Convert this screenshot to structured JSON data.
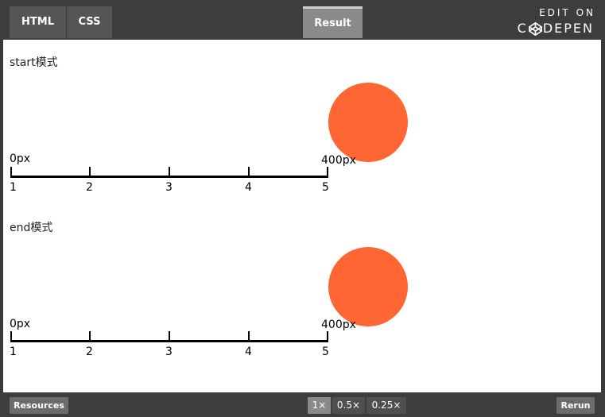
{
  "topbar": {
    "tabs": [
      {
        "label": "HTML"
      },
      {
        "label": "CSS"
      },
      {
        "label": "Result"
      }
    ],
    "brand": {
      "edit_on": "EDIT ON",
      "logo_prefix": "C",
      "logo_suffix": "DEPEN"
    }
  },
  "result": {
    "demos": [
      {
        "title": "start模式",
        "start_label": "0px",
        "end_label": "400px",
        "ticks": [
          "1",
          "2",
          "3",
          "4",
          "5"
        ]
      },
      {
        "title": "end模式",
        "start_label": "0px",
        "end_label": "400px",
        "ticks": [
          "1",
          "2",
          "3",
          "4",
          "5"
        ]
      }
    ],
    "circle_color": "#ff6633"
  },
  "bottombar": {
    "resources_label": "Resources",
    "zoom_options": [
      "1×",
      "0.5×",
      "0.25×"
    ],
    "zoom_selected": "1×",
    "rerun_label": "Rerun"
  }
}
